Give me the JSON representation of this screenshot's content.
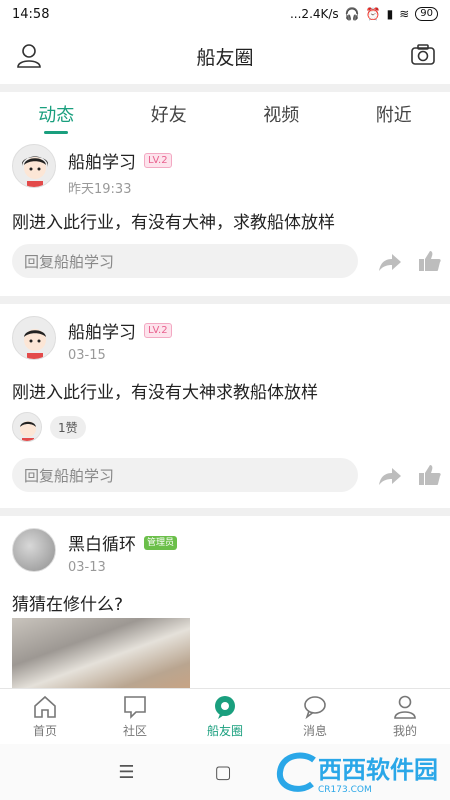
{
  "status": {
    "time": "14:58",
    "speed": "...2.4K/s",
    "battery": "90"
  },
  "header": {
    "title": "船友圈"
  },
  "tabs": [
    {
      "label": "动态",
      "active": true
    },
    {
      "label": "好友",
      "active": false
    },
    {
      "label": "视频",
      "active": false
    },
    {
      "label": "附近",
      "active": false
    }
  ],
  "posts": [
    {
      "name": "船舶学习",
      "badge": "LV.2",
      "time": "昨天19:33",
      "content": "刚进入此行业，有没有大神，求教船体放样",
      "reply_placeholder": "回复船舶学习"
    },
    {
      "name": "船舶学习",
      "badge": "LV.2",
      "time": "03-15",
      "content": "刚进入此行业，有没有大神求教船体放样",
      "likes": "1赞",
      "reply_placeholder": "回复船舶学习"
    },
    {
      "name": "黑白循环",
      "badge": "管理员",
      "time": "03-13",
      "content": "猜猜在修什么?"
    }
  ],
  "bottom_nav": [
    {
      "label": "首页",
      "icon": "home-icon"
    },
    {
      "label": "社区",
      "icon": "chat-box-icon"
    },
    {
      "label": "船友圈",
      "icon": "circle-icon",
      "active": true
    },
    {
      "label": "消息",
      "icon": "message-icon"
    },
    {
      "label": "我的",
      "icon": "person-icon"
    }
  ],
  "watermark": {
    "text": "西西软件园",
    "sub": "CR173.COM"
  },
  "colors": {
    "accent": "#1a9f7e",
    "lv_badge": "#e8628f",
    "admin_badge": "#6bbf4a"
  }
}
